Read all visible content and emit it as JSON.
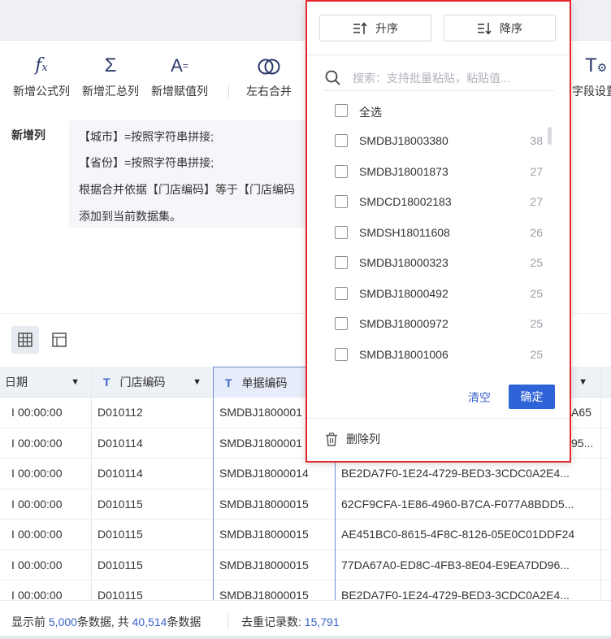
{
  "toolbar": {
    "items": [
      {
        "label": "新增公式列",
        "icon": "formula-icon"
      },
      {
        "label": "新增汇总列",
        "icon": "sigma-icon"
      },
      {
        "label": "新增赋值列",
        "icon": "assign-icon"
      },
      {
        "label": "左右合并",
        "icon": "merge-circles-icon"
      },
      {
        "label": "字段设置",
        "icon": "field-settings-icon"
      }
    ]
  },
  "description": {
    "label": "新增列",
    "lines": [
      "【城市】=按照字符串拼接;",
      "【省份】=按照字符串拼接;",
      "根据合并依据【门店编码】等于【门店编码",
      "添加到当前数据集。"
    ]
  },
  "grid": {
    "headers": [
      {
        "label": "日期",
        "type_icon": ""
      },
      {
        "label": "门店编码",
        "type_icon": "T"
      },
      {
        "label": "单据编码",
        "type_icon": "T"
      },
      {
        "label": "",
        "type_icon": ""
      }
    ],
    "rows": [
      {
        "date": "00:00:00",
        "store": "D010112",
        "doc": "SMDBJ1800001",
        "guid": "A65"
      },
      {
        "date": "00:00:00",
        "store": "D010114",
        "doc": "SMDBJ1800001",
        "guid": "95..."
      },
      {
        "date": "00:00:00",
        "store": "D010114",
        "doc": "SMDBJ18000014",
        "guid": "BE2DA7F0-1E24-4729-BED3-3CDC0A2E4..."
      },
      {
        "date": "00:00:00",
        "store": "D010115",
        "doc": "SMDBJ18000015",
        "guid": "62CF9CFA-1E86-4960-B7CA-F077A8BDD5..."
      },
      {
        "date": "00:00:00",
        "store": "D010115",
        "doc": "SMDBJ18000015",
        "guid": "AE451BC0-8615-4F8C-8126-05E0C01DDF24"
      },
      {
        "date": "00:00:00",
        "store": "D010115",
        "doc": "SMDBJ18000015",
        "guid": "77DA67A0-ED8C-4FB3-8E04-E9EA7DD96..."
      },
      {
        "date": "00:00:00",
        "store": "D010115",
        "doc": "SMDBJ18000015",
        "guid": "BE2DA7F0-1E24-4729-BED3-3CDC0A2E4..."
      }
    ]
  },
  "footer": {
    "prefix": "显示前",
    "shown": "5,000",
    "mid": "条数据, 共",
    "total": "40,514",
    "suffix": "条数据",
    "dedup_label": "去重记录数:",
    "dedup_count": "15,791"
  },
  "popup": {
    "sort_asc": "升序",
    "sort_desc": "降序",
    "search_placeholder": "搜索：支持批量粘贴，粘贴值...",
    "select_all": "全选",
    "options": [
      {
        "value": "SMDBJ18003380",
        "count": "38"
      },
      {
        "value": "SMDBJ18001873",
        "count": "27"
      },
      {
        "value": "SMDCD18002183",
        "count": "27"
      },
      {
        "value": "SMDSH18011608",
        "count": "26"
      },
      {
        "value": "SMDBJ18000323",
        "count": "25"
      },
      {
        "value": "SMDBJ18000492",
        "count": "25"
      },
      {
        "value": "SMDBJ18000972",
        "count": "25"
      },
      {
        "value": "SMDBJ18001006",
        "count": "25"
      }
    ],
    "clear": "清空",
    "confirm": "确定",
    "delete_column": "删除列"
  },
  "colors": {
    "accent": "#2f63d8",
    "highlight_border": "#e5262b",
    "link": "#3a64c8"
  }
}
